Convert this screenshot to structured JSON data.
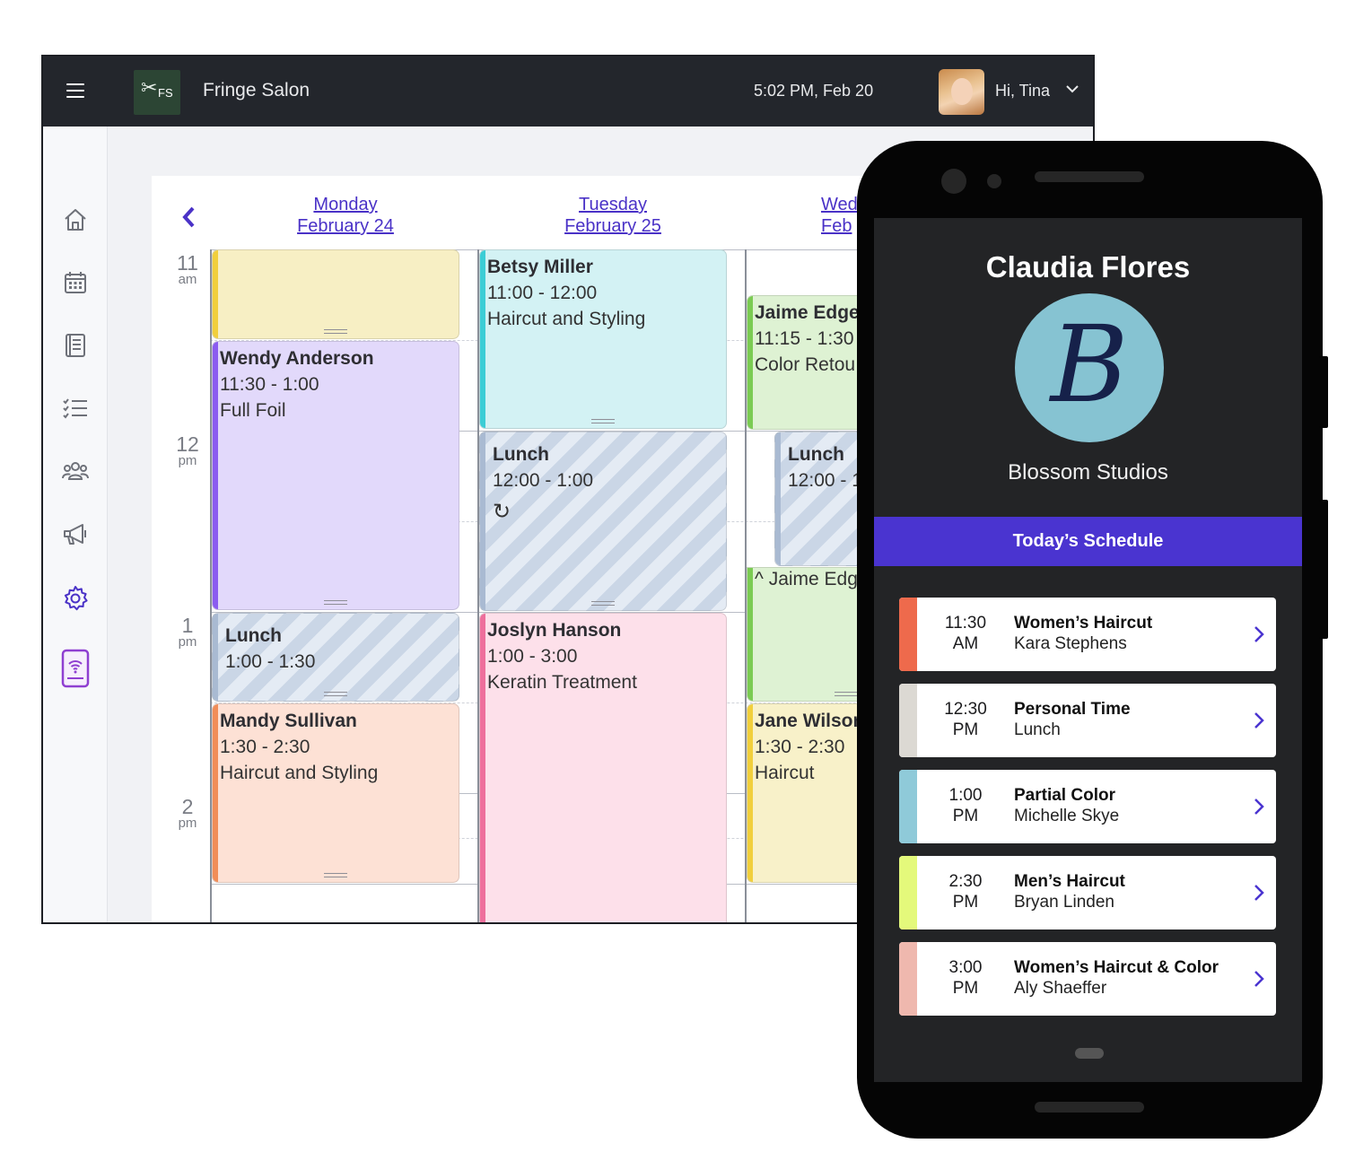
{
  "topbar": {
    "logo_text": "FS",
    "app_title": "Fringe Salon",
    "clock": "5:02 PM, Feb 20",
    "greeting": "Hi, Tina"
  },
  "sidebar": {
    "items": [
      {
        "icon": "home-icon"
      },
      {
        "icon": "calendar-icon"
      },
      {
        "icon": "book-icon"
      },
      {
        "icon": "checklist-icon"
      },
      {
        "icon": "clients-icon"
      },
      {
        "icon": "megaphone-icon"
      },
      {
        "icon": "gear-icon"
      },
      {
        "icon": "mobile-app-icon"
      }
    ]
  },
  "calendar": {
    "days": [
      {
        "weekday": "Monday",
        "date": "February 24"
      },
      {
        "weekday": "Tuesday",
        "date": "February 25"
      },
      {
        "weekday": "Wed",
        "date": "Feb"
      }
    ],
    "times": [
      {
        "h": "11",
        "ap": "am"
      },
      {
        "h": "12",
        "ap": "pm"
      },
      {
        "h": "1",
        "ap": "pm"
      },
      {
        "h": "2",
        "ap": "pm"
      }
    ],
    "appointments": {
      "mon_wendy": {
        "name": "Wendy Anderson",
        "time": "11:30 - 1:00",
        "service": "Full Foil"
      },
      "mon_lunch": {
        "name": "Lunch",
        "time": "1:00 - 1:30"
      },
      "mon_mandy": {
        "name": "Mandy Sullivan",
        "time": "1:30 - 2:30",
        "service": "Haircut and Styling"
      },
      "tue_betsy": {
        "name": "Betsy Miller",
        "time": "11:00 - 12:00",
        "service": "Haircut and Styling"
      },
      "tue_lunch": {
        "name": "Lunch",
        "time": "12:00 - 1:00"
      },
      "tue_joslyn": {
        "name": "Joslyn Hanson",
        "time": "1:00 - 3:00",
        "service": "Keratin Treatment"
      },
      "wed_jaime": {
        "name": "Jaime Edge",
        "time": "11:15 - 1:30",
        "service": "Color Retou"
      },
      "wed_lunch": {
        "name": "Lunch",
        "time": "12:00 - 1"
      },
      "wed_jaime_cont": {
        "name": "^ Jaime Edg"
      },
      "wed_jane": {
        "name": "Jane Wilson",
        "time": "1:30 - 2:30",
        "service": "Haircut"
      }
    },
    "colors": {
      "yellow": "#f7efc4",
      "purple": "#e2d9fb",
      "cyan": "#d3f2f4",
      "pink": "#fde0ea",
      "peach": "#fde1d5",
      "green": "#def2d3"
    }
  },
  "phone": {
    "stylist_name": "Claudia Flores",
    "logo_letter": "B",
    "business_name": "Blossom Studios",
    "schedule_title": "Today’s Schedule",
    "appointments": [
      {
        "time1": "11:30",
        "time2": "AM",
        "service": "Women’s Haircut",
        "client": "Kara Stephens",
        "color": "#ee6a4c"
      },
      {
        "time1": "12:30",
        "time2": "PM",
        "service": "Personal Time",
        "client": "Lunch",
        "color": "#dcd9d3"
      },
      {
        "time1": "1:00",
        "time2": "PM",
        "service": "Partial Color",
        "client": "Michelle Skye",
        "color": "#8fcad9"
      },
      {
        "time1": "2:30",
        "time2": "PM",
        "service": "Men’s Haircut",
        "client": "Bryan Linden",
        "color": "#e4f97b"
      },
      {
        "time1": "3:00",
        "time2": "PM",
        "service": "Women’s Haircut & Color",
        "client": "Aly Shaeffer",
        "color": "#efb8ae"
      }
    ]
  }
}
